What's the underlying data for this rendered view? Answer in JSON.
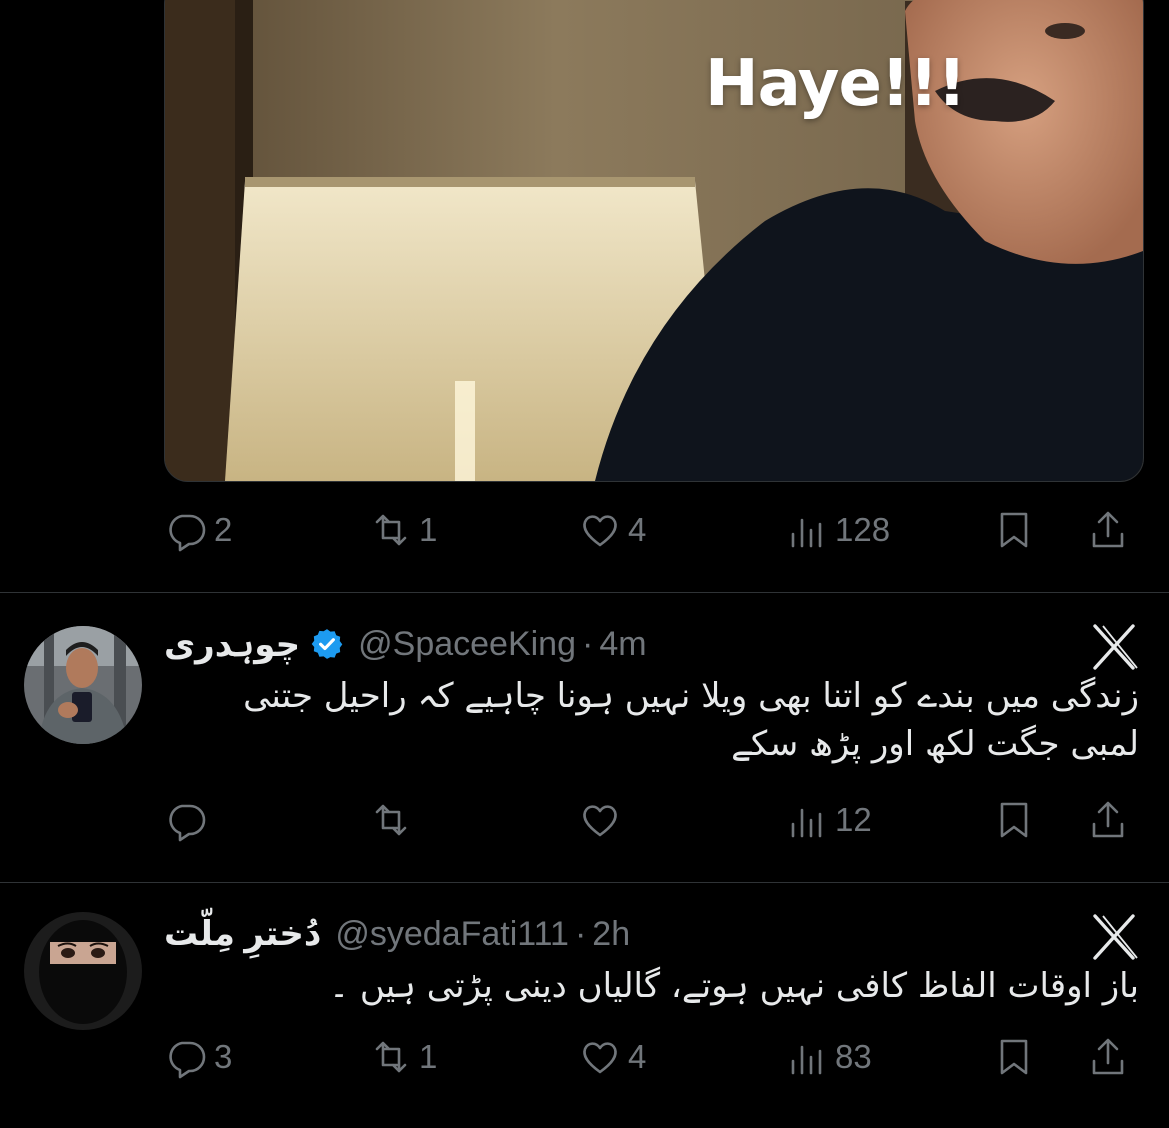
{
  "tweet1": {
    "media": {
      "caption": "Haye!!!"
    },
    "stats": {
      "replies": "2",
      "reposts": "1",
      "likes": "4",
      "views": "128"
    }
  },
  "tweet2": {
    "display_name": "چوہدری",
    "handle": "@SpaceeKing",
    "separator": "·",
    "time": "4m",
    "text": "زندگی میں بندے کو اتنا بھی ویلا  نہیں ہونا چاہیے کہ راحیل جتنی\nلمبی جگت لکھ اور پڑھ سکے",
    "stats": {
      "replies": "",
      "reposts": "",
      "likes": "",
      "views": "12"
    }
  },
  "tweet3": {
    "display_name": "دُخترِ مِلّت",
    "handle": "@syedaFati111",
    "separator": "·",
    "time": "2h",
    "text": "باز اوقات الفاظ کافی نہیں ہوتے، گالیاں دینی پڑتی ہیں ۔",
    "stats": {
      "replies": "3",
      "reposts": "1",
      "likes": "4",
      "views": "83"
    }
  },
  "colors": {
    "background": "#000000",
    "text": "#e7e9ea",
    "muted": "#71767b",
    "divider": "#2f3336",
    "verified": "#1d9bf0"
  },
  "icons": [
    "reply-icon",
    "repost-icon",
    "like-icon",
    "views-icon",
    "bookmark-icon",
    "share-icon",
    "verified-badge-icon",
    "x-logo-icon"
  ]
}
